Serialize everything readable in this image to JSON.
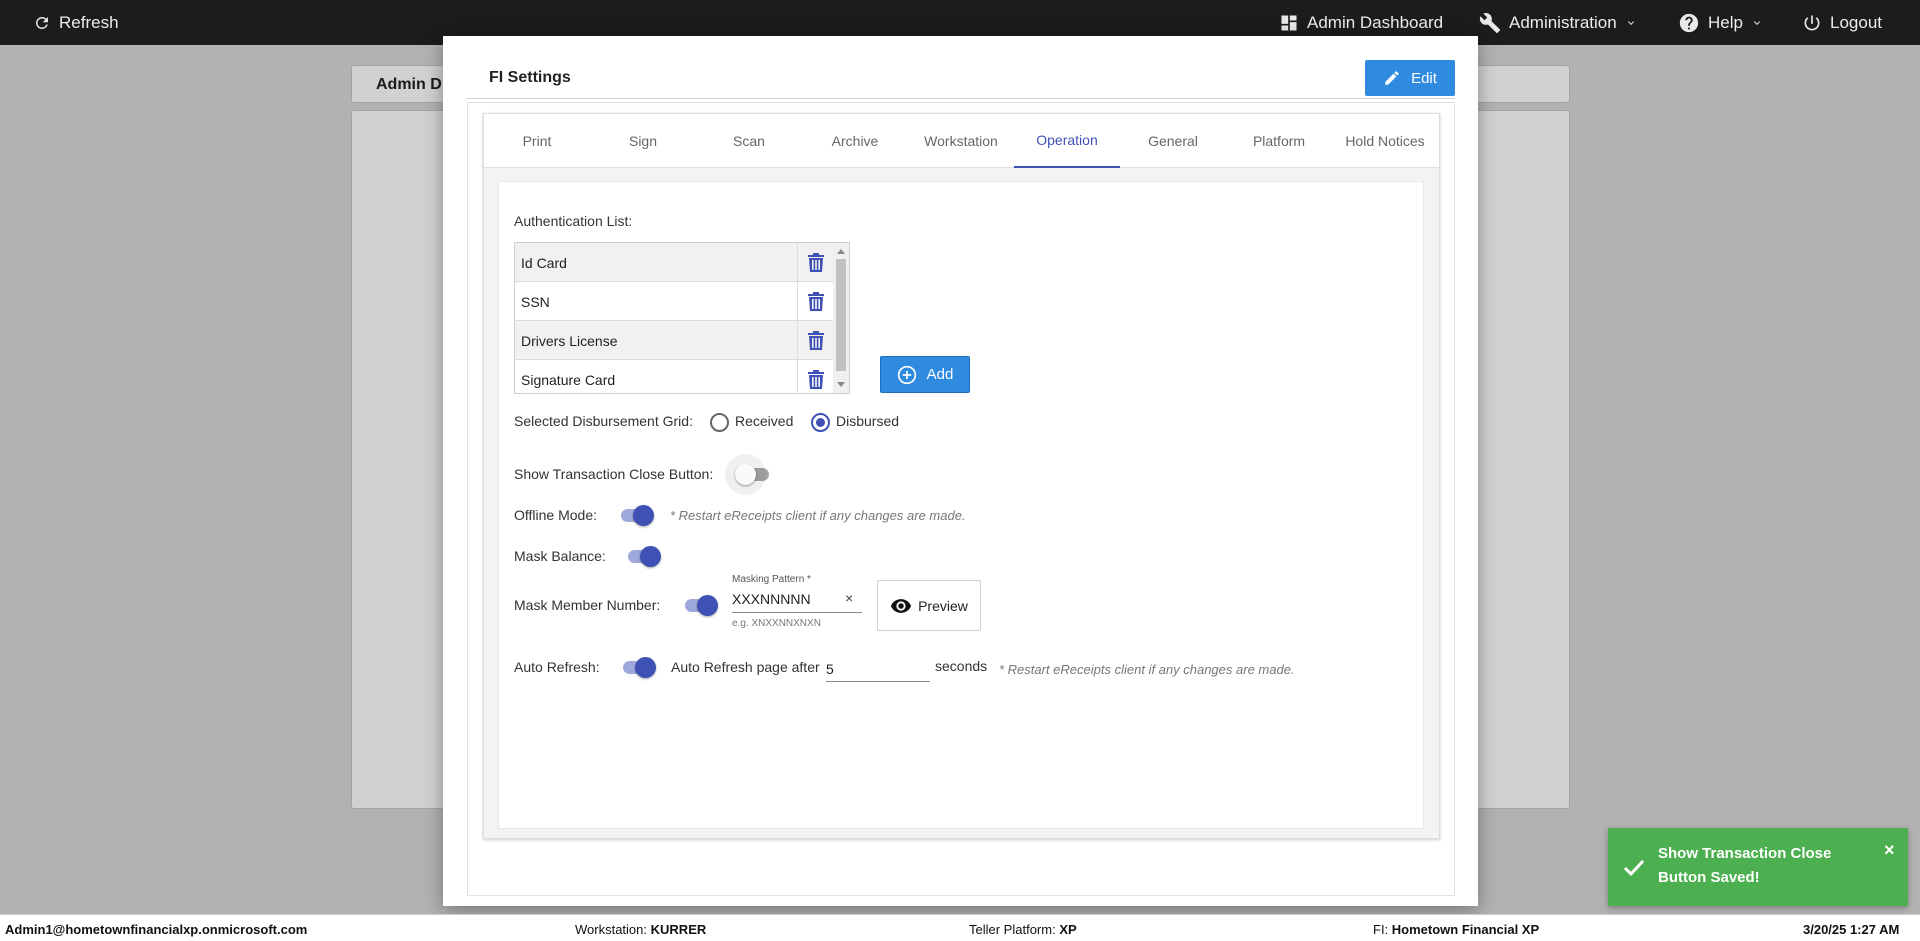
{
  "topbar": {
    "refresh_label": "Refresh",
    "admin_dashboard_label": "Admin Dashboard",
    "administration_label": "Administration",
    "help_label": "Help",
    "logout_label": "Logout"
  },
  "background": {
    "header_text": "Admin D"
  },
  "dialog": {
    "title": "FI Settings",
    "edit_label": "Edit",
    "tabs": [
      {
        "label": "Print"
      },
      {
        "label": "Sign"
      },
      {
        "label": "Scan"
      },
      {
        "label": "Archive"
      },
      {
        "label": "Workstation"
      },
      {
        "label": "Operation",
        "active": true
      },
      {
        "label": "General"
      },
      {
        "label": "Platform"
      },
      {
        "label": "Hold Notices"
      }
    ],
    "operation": {
      "auth_list_label": "Authentication List:",
      "auth_items": [
        {
          "label": "Id Card"
        },
        {
          "label": "SSN"
        },
        {
          "label": "Drivers License"
        },
        {
          "label": "Signature Card"
        }
      ],
      "add_label": "Add",
      "disbursement_label": "Selected Disbursement Grid:",
      "received_label": "Received",
      "disbursed_label": "Disbursed",
      "disbursement_selected": "Disbursed",
      "show_close_label": "Show Transaction Close Button:",
      "show_close_on": false,
      "offline_label": "Offline Mode:",
      "offline_on": true,
      "restart_note": "* Restart eReceipts client if any changes are made.",
      "mask_balance_label": "Mask Balance:",
      "mask_balance_on": true,
      "mask_member_label": "Mask Member Number:",
      "mask_member_on": true,
      "masking_pattern_label": "Masking Pattern *",
      "masking_pattern_value": "XXXNNNNN",
      "masking_pattern_hint": "e.g. XNXXNNXNXN",
      "preview_label": "Preview",
      "auto_refresh_label": "Auto Refresh:",
      "auto_refresh_on": true,
      "auto_refresh_after_label": "Auto Refresh page after",
      "auto_refresh_value": "5",
      "seconds_label": "seconds",
      "restart_note_2": "* Restart eReceipts client if any changes are made."
    }
  },
  "toast": {
    "message": "Show Transaction Close Button Saved!",
    "close_glyph": "×",
    "color": "#4caf50"
  },
  "statusbar": {
    "user": "Admin1@hometownfinancialxp.onmicrosoft.com",
    "workstation_label": "Workstation:",
    "workstation_value": "KURRER",
    "platform_label": "Teller Platform:",
    "platform_value": "XP",
    "fi_label": "FI:",
    "fi_value": "Hometown Financial XP",
    "datetime": "3/20/25 1:27 AM"
  },
  "colors": {
    "accent": "#3f51b5",
    "button_blue": "#2f8be0",
    "topbar": "#1c1c1c"
  }
}
